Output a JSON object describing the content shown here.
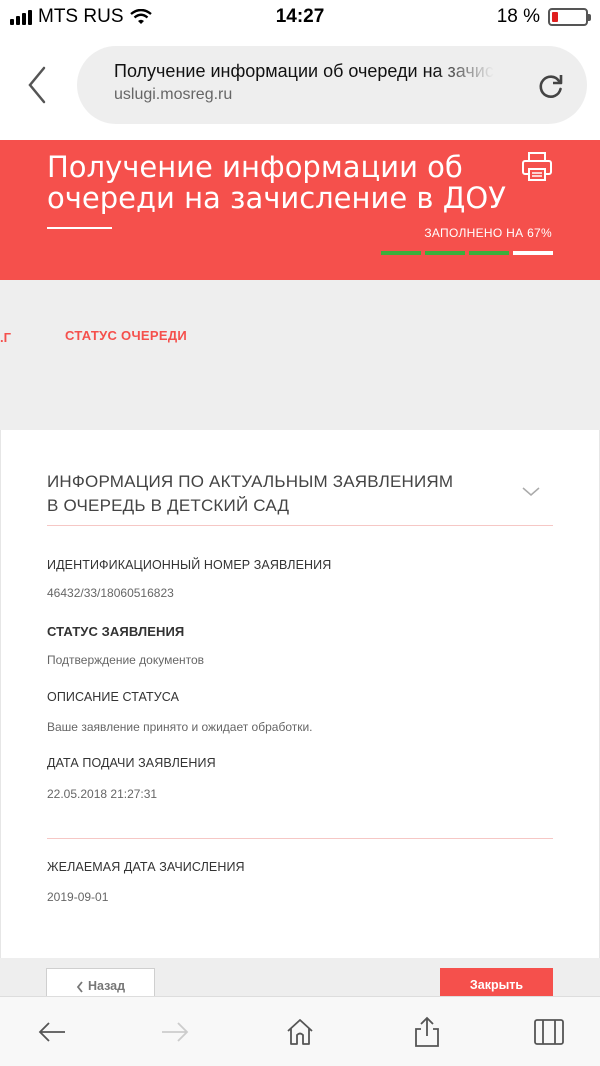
{
  "status_bar": {
    "carrier": "MTS RUS",
    "time": "14:27",
    "battery_percent": "18 %",
    "battery_level": 0.18
  },
  "browser": {
    "page_title": "Получение информации об очереди на зачисление в ДОУ",
    "host": "uslugi.mosreg.ru"
  },
  "header": {
    "title": "Получение информации об очереди на зачисление в ДОУ",
    "progress_label": "ЗАПОЛНЕНО НА 67%",
    "progress_fraction": 0.67,
    "progress_segments": 4,
    "progress_filled": 3,
    "colors": {
      "brand": "#f5504c",
      "progress_done": "#3cae3c",
      "progress_todo": "#ffffff"
    }
  },
  "steps": {
    "previous_fragment": ".Г",
    "current": "СТАТУС ОЧЕРЕДИ"
  },
  "section": {
    "title": "ИНФОРМАЦИЯ ПО АКТУАЛЬНЫМ ЗАЯВЛЕНИЯМ В ОЧЕРЕДЬ В ДЕТСКИЙ САД"
  },
  "fields": [
    {
      "label": "ИДЕНТИФИКАЦИОННЫЙ НОМЕР ЗАЯВЛЕНИЯ",
      "value": "46432/33/18060516823"
    },
    {
      "label": "СТАТУС ЗАЯВЛЕНИЯ",
      "value": "Подтверждение документов"
    },
    {
      "label": "ОПИСАНИЕ СТАТУСА",
      "value": "Ваше заявление принято и ожидает обработки."
    },
    {
      "label": "ДАТА ПОДАЧИ ЗАЯВЛЕНИЯ",
      "value": "22.05.2018 21:27:31"
    },
    {
      "label": "ЖЕЛАЕМАЯ ДАТА ЗАЧИСЛЕНИЯ",
      "value": "2019-09-01"
    }
  ],
  "actions": {
    "back_label": "Назад",
    "close_label": "Закрыть"
  },
  "toolbar": {
    "icons": [
      "back-icon",
      "forward-icon",
      "home-icon",
      "share-icon",
      "tabs-icon"
    ]
  }
}
